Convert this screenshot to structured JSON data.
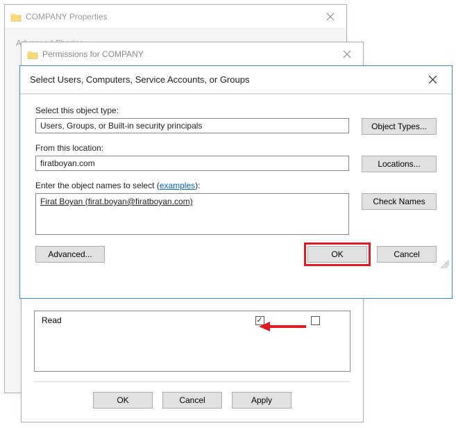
{
  "w1": {
    "title": "COMPANY Properties",
    "tab": "Advanced Sharing"
  },
  "w2": {
    "title": "Permissions for COMPANY",
    "read_label": "Read",
    "ok": "OK",
    "cancel": "Cancel",
    "apply": "Apply"
  },
  "w3": {
    "title": "Select Users, Computers, Service Accounts, or Groups",
    "obj_type_label": "Select this object type:",
    "obj_type_value": "Users, Groups, or Built-in security principals",
    "obj_types_btn": "Object Types...",
    "loc_label": "From this location:",
    "loc_value": "firatboyan.com",
    "loc_btn": "Locations...",
    "names_label_prefix": "Enter the object names to select (",
    "names_label_link": "examples",
    "names_label_suffix": "):",
    "entry": "Firat Boyan (firat.boyan@firatboyan.com)",
    "check_btn": "Check Names",
    "advanced": "Advanced...",
    "ok": "OK",
    "cancel": "Cancel"
  }
}
